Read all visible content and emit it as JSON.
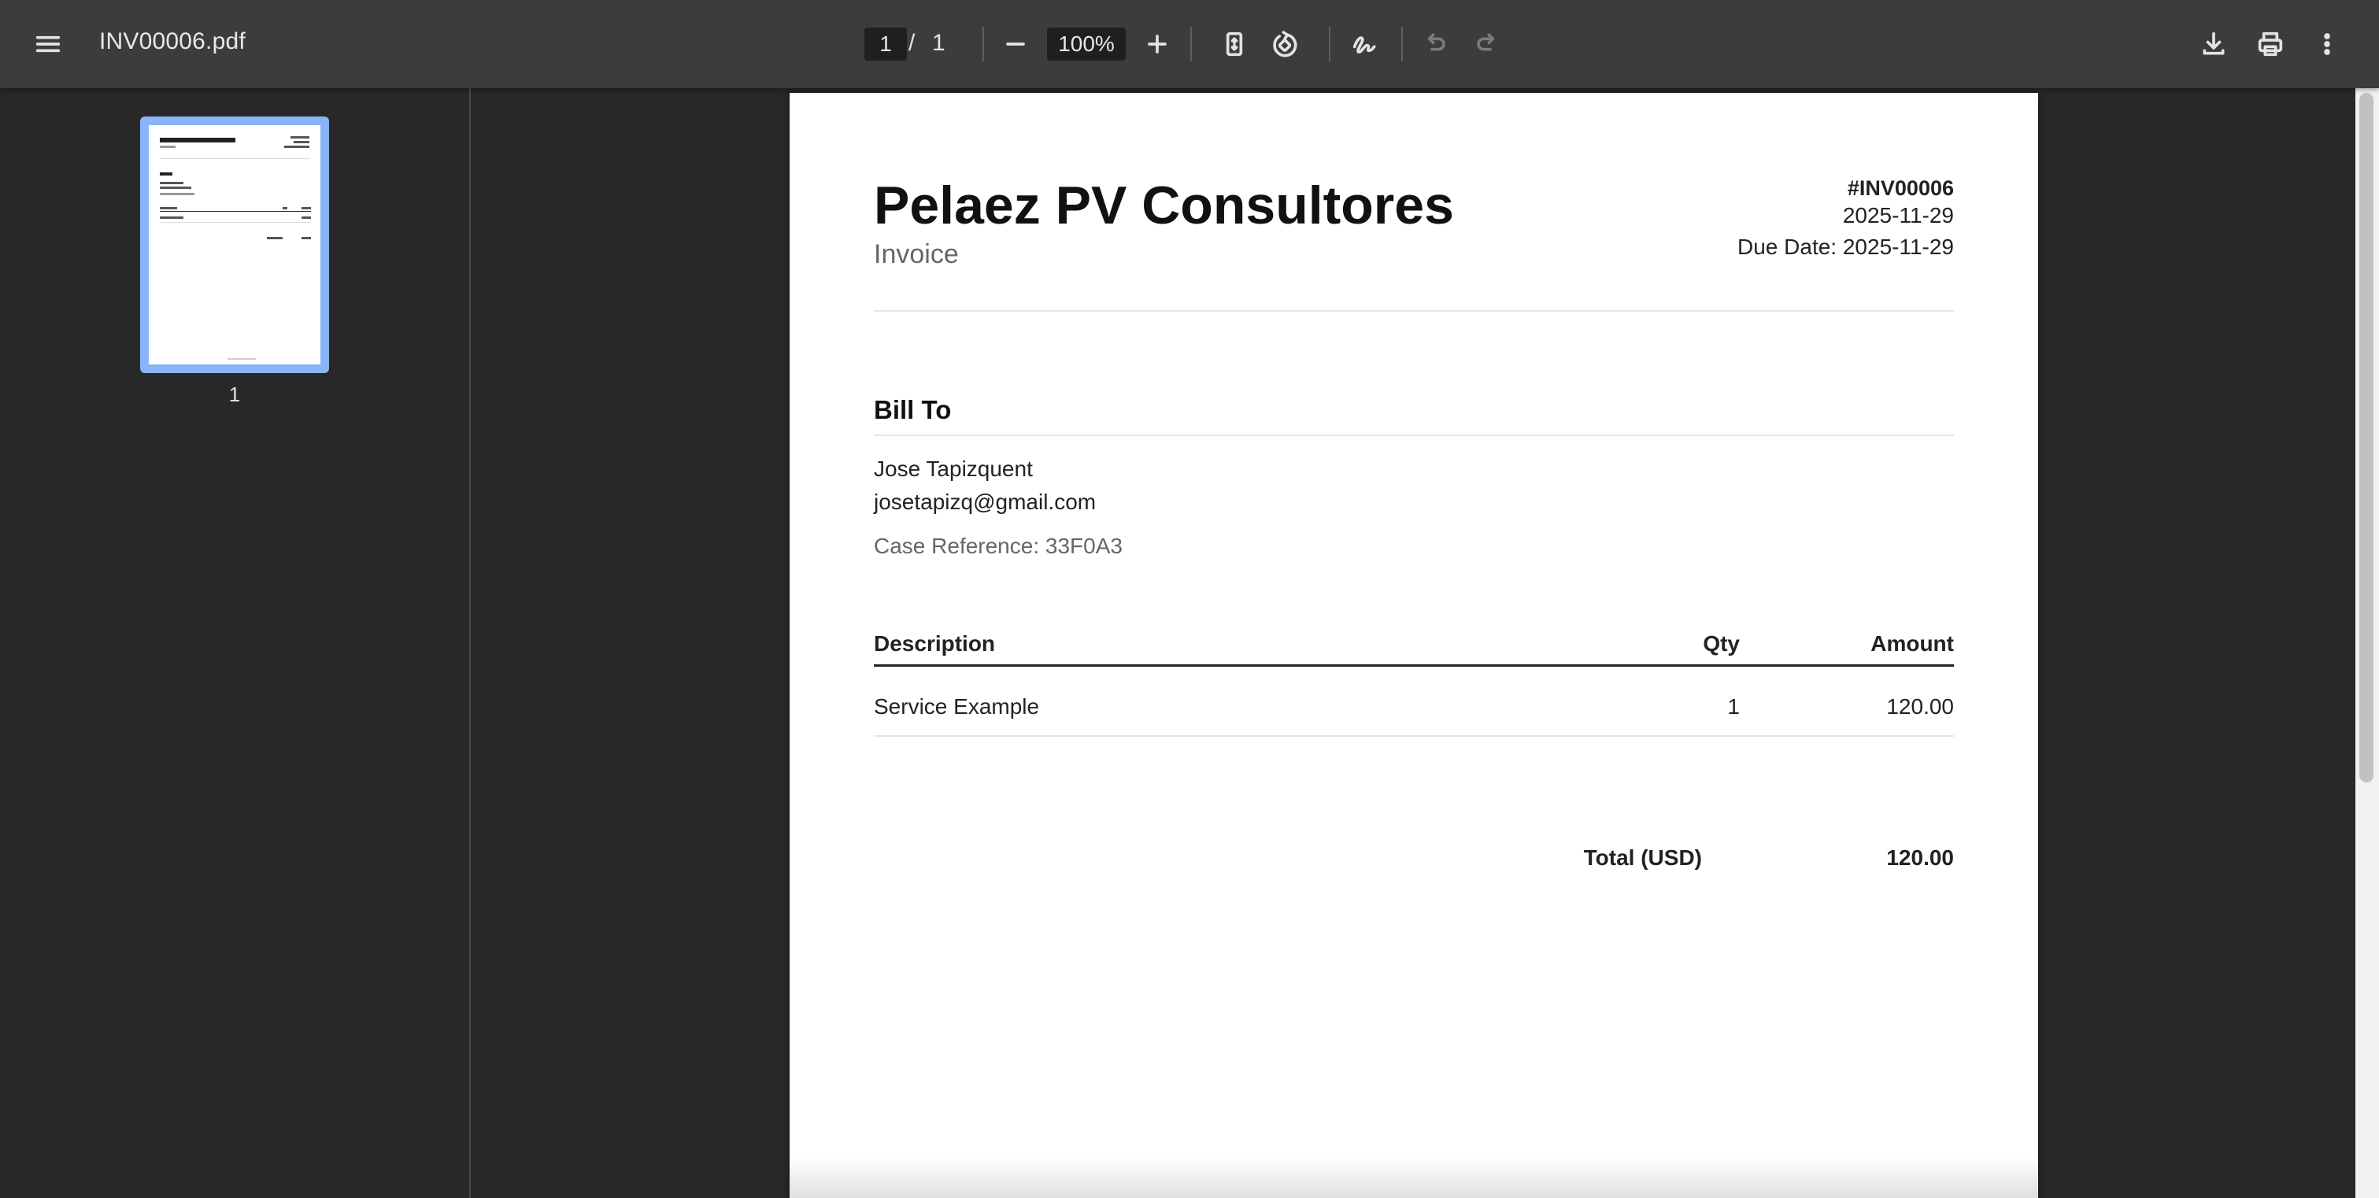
{
  "toolbar": {
    "file_name": "INV00006.pdf",
    "current_page": "1",
    "page_separator": "/",
    "total_pages": "1",
    "zoom": "100%",
    "icons": [
      "menu-icon",
      "zoom-out-icon",
      "zoom-in-icon",
      "fit-page-icon",
      "rotate-icon",
      "annotate-icon",
      "undo-icon",
      "redo-icon",
      "download-icon",
      "print-icon",
      "more-vert-icon"
    ]
  },
  "sidebar": {
    "thumbnails": [
      {
        "label": "1",
        "selected": true
      }
    ],
    "accent": "#8ab4f8"
  },
  "document": {
    "company": "Pelaez PV Consultores",
    "doc_type": "Invoice",
    "invoice_number": "#INV00006",
    "date": "2025-11-29",
    "due_date": "Due Date: 2025-11-29",
    "bill_to_heading": "Bill To",
    "client_name": "Jose Tapizquent",
    "client_email": "josetapizq@gmail.com",
    "case_reference": "Case Reference: 33F0A3",
    "table": {
      "headers": {
        "description": "Description",
        "qty": "Qty",
        "amount": "Amount"
      },
      "rows": [
        {
          "description": "Service Example",
          "qty": "1",
          "amount": "120.00"
        }
      ]
    },
    "total_label": "Total (USD)",
    "total_value": "120.00"
  }
}
